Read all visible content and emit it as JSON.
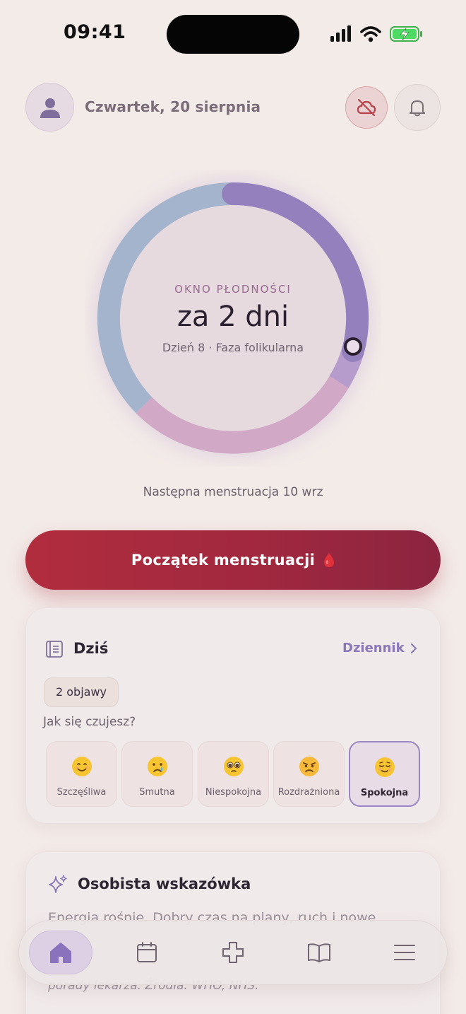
{
  "status_bar": {
    "time": "09:41",
    "icons": [
      "cellular-signal-icon",
      "wifi-icon",
      "battery-charging-icon"
    ]
  },
  "header": {
    "date": "Czwartek, 20 sierpnia",
    "avatar_icon": "user-icon",
    "sync_icon": "cloud-off-icon",
    "notifications_icon": "bell-icon"
  },
  "cycle": {
    "label": "OKNO PŁODNOŚCI",
    "headline": "za 2 dni",
    "subline": "Dzień 8 · Faza folikularna",
    "next_period": "Następna menstruacja 10 wrz"
  },
  "period_button": {
    "label": "Początek menstruacji",
    "icon": "blood-drop-icon"
  },
  "today": {
    "title": "Dziś",
    "journal_link": "Dziennik",
    "symptoms_chip": "2 objawy",
    "feeling_question": "Jak się czujesz?",
    "moods": [
      {
        "label": "Szczęśliwa",
        "icon": "smiling-face-icon",
        "selected": false
      },
      {
        "label": "Smutna",
        "icon": "crying-face-icon",
        "selected": false
      },
      {
        "label": "Niespokojna",
        "icon": "pleading-face-icon",
        "selected": false
      },
      {
        "label": "Rozdrażniona",
        "icon": "angry-face-icon",
        "selected": false
      },
      {
        "label": "Spokojna",
        "icon": "relieved-face-icon",
        "selected": true
      }
    ]
  },
  "tip": {
    "title": "Osobista wskazówka",
    "text": "Energia rośnie. Dobry czas na plany, ruch i nowe",
    "source": "porady lekarza. Źródła: WHO, NHS."
  },
  "bottom_nav": {
    "items": [
      {
        "name": "home",
        "icon": "home-icon",
        "active": true
      },
      {
        "name": "calendar",
        "icon": "calendar-icon",
        "active": false
      },
      {
        "name": "health",
        "icon": "plus-cross-icon",
        "active": false
      },
      {
        "name": "library",
        "icon": "book-icon",
        "active": false
      },
      {
        "name": "menu",
        "icon": "menu-icon",
        "active": false
      }
    ]
  },
  "colors": {
    "background": "#f3ebe8",
    "accent_purple": "#8a78b8",
    "period_red": "#a1283f",
    "ring_blue": "#9fb3cf",
    "ring_purple": "#9480bd",
    "ring_pink": "#d2a6c6"
  }
}
